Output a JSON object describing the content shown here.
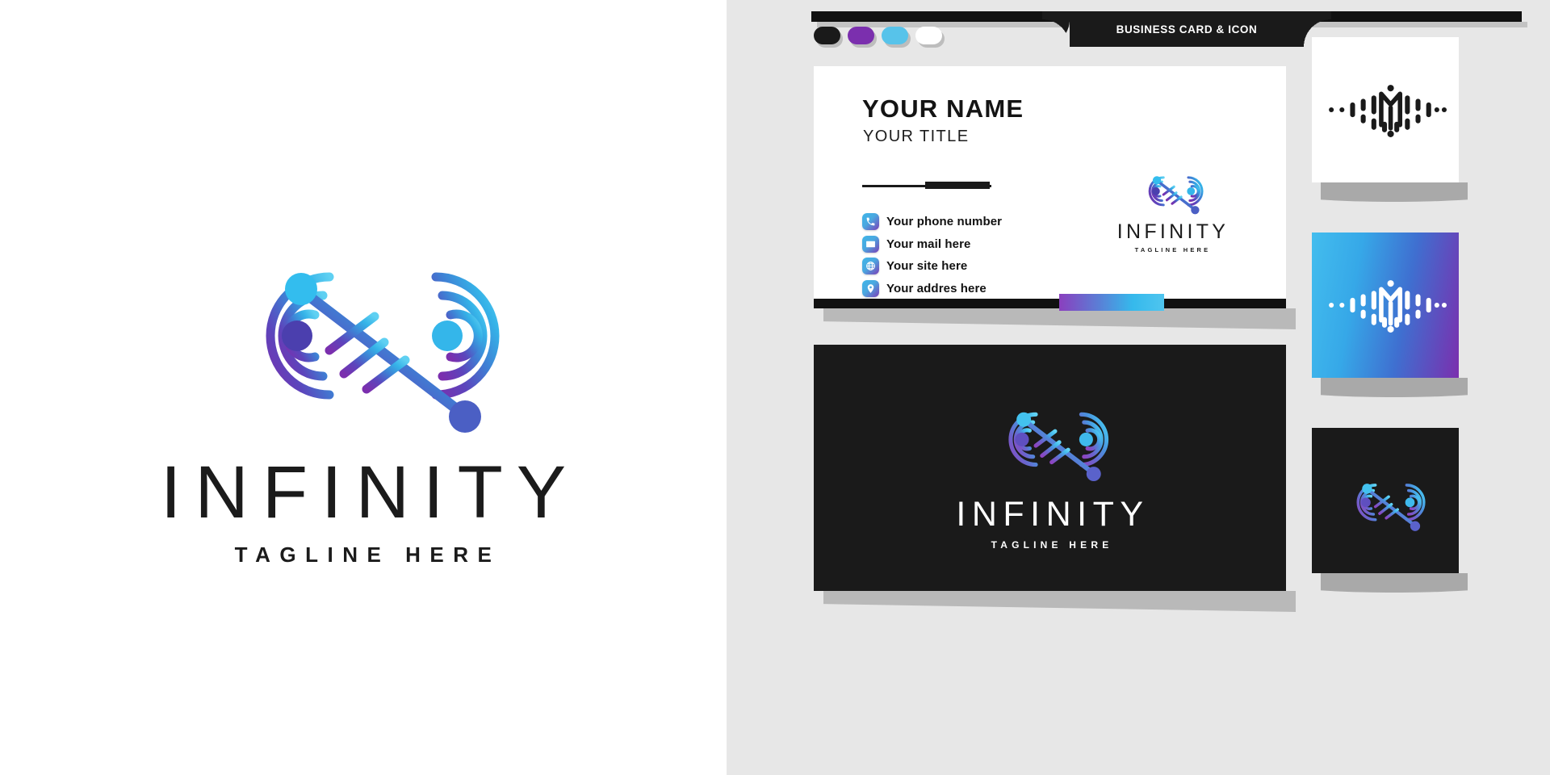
{
  "brand": {
    "name": "INFINITY",
    "tagline": "TAGLINE HERE",
    "colors": {
      "purple": "#7b2fae",
      "cyan": "#3fc0ef",
      "blue": "#3f6fd0",
      "black": "#1a1a1a",
      "white": "#ffffff",
      "panel_gray": "#e7e7e7"
    }
  },
  "left_panel": {
    "logo_name": "infinity-circuit-logo",
    "wordmark": "INFINITY",
    "tagline": "TAGLINE HERE"
  },
  "right_panel": {
    "header": {
      "label": "BUSINESS CARD & ICON"
    },
    "swatches": [
      {
        "name": "swatch-black",
        "color": "#1a1a1a"
      },
      {
        "name": "swatch-purple",
        "color": "#7b2fae"
      },
      {
        "name": "swatch-cyan",
        "color": "#57c3ea"
      },
      {
        "name": "swatch-white",
        "color": "#ffffff"
      }
    ],
    "card_front": {
      "name": "YOUR NAME",
      "title": "YOUR TITLE",
      "contacts": [
        {
          "icon": "phone-icon",
          "text": "Your phone number"
        },
        {
          "icon": "mail-icon",
          "text": "Your mail here"
        },
        {
          "icon": "globe-icon",
          "text": "Your site here"
        },
        {
          "icon": "location-pin-icon",
          "text": "Your addres here"
        }
      ],
      "logo_word": "INFINITY",
      "logo_tagline": "TAGLINE HERE"
    },
    "card_back": {
      "logo_word": "INFINITY",
      "logo_tagline": "TAGLINE HERE"
    },
    "icon_boxes": [
      {
        "name": "icon-variant-light",
        "background": "#ffffff",
        "mark": "soundwave-m-icon",
        "mark_color": "#1a1a1a"
      },
      {
        "name": "icon-variant-gradient",
        "background": "linear-gradient cyan to purple",
        "mark": "soundwave-m-icon",
        "mark_color": "#ffffff"
      },
      {
        "name": "icon-variant-dark",
        "background": "#1a1a1a",
        "mark": "infinity-circuit-icon",
        "mark_color": "gradient"
      }
    ]
  }
}
